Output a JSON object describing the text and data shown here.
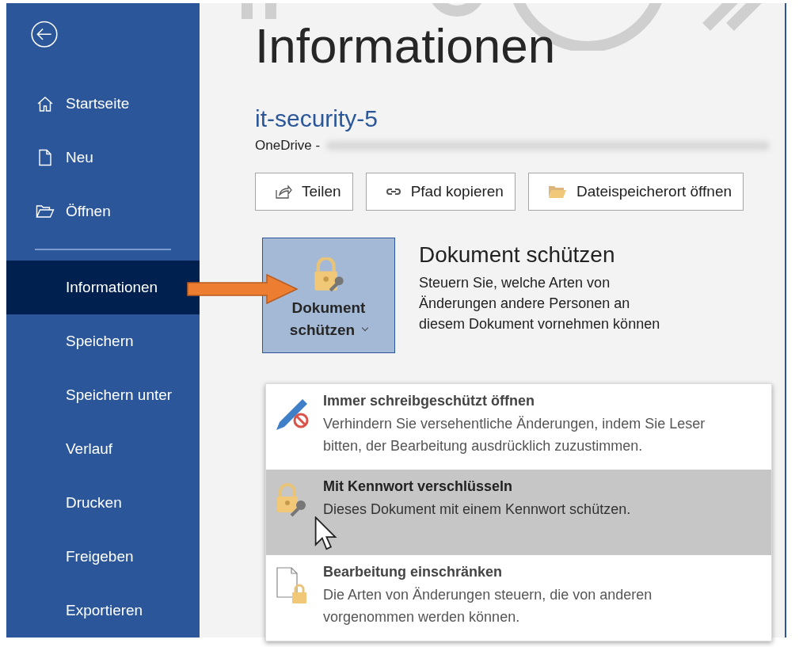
{
  "sidebar": {
    "items": [
      {
        "label": "Startseite",
        "selected": false
      },
      {
        "label": "Neu",
        "selected": false
      },
      {
        "label": "Öffnen",
        "selected": false
      },
      {
        "label": "Informationen",
        "selected": true
      },
      {
        "label": "Speichern",
        "selected": false
      },
      {
        "label": "Speichern unter",
        "selected": false
      },
      {
        "label": "Verlauf",
        "selected": false
      },
      {
        "label": "Drucken",
        "selected": false
      },
      {
        "label": "Freigeben",
        "selected": false
      },
      {
        "label": "Exportieren",
        "selected": false
      }
    ]
  },
  "page_title": "Informationen",
  "document": {
    "name": "it-security-5",
    "location": "OneDrive -"
  },
  "buttons": [
    "Teilen",
    "Pfad kopieren",
    "Dateispeicherort öffnen"
  ],
  "protect": {
    "button": [
      "Dokument",
      "schützen"
    ],
    "heading": "Dokument schützen",
    "description": "Steuern Sie, welche Arten von Änderungen andere Personen an diesem Dokument vornehmen können"
  },
  "menu": {
    "items": [
      {
        "title": "Immer schreibgeschützt öffnen",
        "description": "Verhindern Sie versehentliche Änderungen, indem Sie Leser bitten, der Bearbeitung ausdrücklich zuzustimmen.",
        "selected": false
      },
      {
        "title": "Mit Kennwort verschlüsseln",
        "description": "Dieses Dokument mit einem Kennwort schützen.",
        "selected": true
      },
      {
        "title": "Bearbeitung einschränken",
        "description": "Die Arten von Änderungen steuern, die von anderen vorgenommen werden können.",
        "selected": false
      }
    ]
  }
}
